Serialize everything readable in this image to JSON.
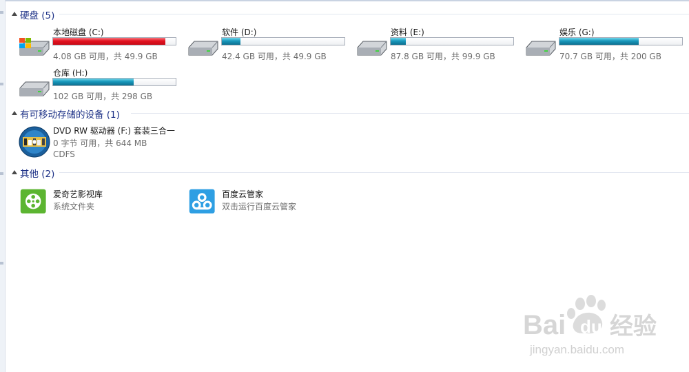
{
  "groups": {
    "hard_disks": {
      "title": "硬盘 (5)",
      "drives": [
        {
          "name": "本地磁盘 (C:)",
          "info": "4.08 GB 可用，共 49.9 GB",
          "used_fraction": 0.918,
          "bar_color": "#e3121f",
          "icon": "windows-drive-icon"
        },
        {
          "name": "软件 (D:)",
          "info": "42.4 GB 可用，共 49.9 GB",
          "used_fraction": 0.15,
          "bar_color": "#1897bb",
          "icon": "hard-drive-icon"
        },
        {
          "name": "资料 (E:)",
          "info": "87.8 GB 可用，共 99.9 GB",
          "used_fraction": 0.121,
          "bar_color": "#1897bb",
          "icon": "hard-drive-icon"
        },
        {
          "name": "娱乐 (G:)",
          "info": "70.7 GB 可用，共 200 GB",
          "used_fraction": 0.646,
          "bar_color": "#1897bb",
          "icon": "hard-drive-icon"
        },
        {
          "name": "仓库 (H:)",
          "info": "102 GB 可用，共 298 GB",
          "used_fraction": 0.658,
          "bar_color": "#1897bb",
          "icon": "hard-drive-icon"
        }
      ]
    },
    "removable": {
      "title": "有可移动存储的设备 (1)",
      "devices": [
        {
          "name": "DVD RW 驱动器 (F:) 套装三合一",
          "info": "0 字节 可用，共 644 MB",
          "filesystem": "CDFS",
          "icon": "dvd-disc-icon"
        }
      ]
    },
    "other": {
      "title": "其他 (2)",
      "items": [
        {
          "name": "爱奇艺影视库",
          "description": "系统文件夹",
          "icon": "iqiyi-film-reel-icon",
          "color": "#5cb531"
        },
        {
          "name": "百度云管家",
          "description": "双击运行百度云管家",
          "icon": "baidu-cloud-icon",
          "color": "#2e9fe3"
        }
      ]
    }
  },
  "watermark": {
    "logo_text": "Bai",
    "logo_text2": "du",
    "cn_text": "经验",
    "url": "jingyan.baidu.com"
  }
}
